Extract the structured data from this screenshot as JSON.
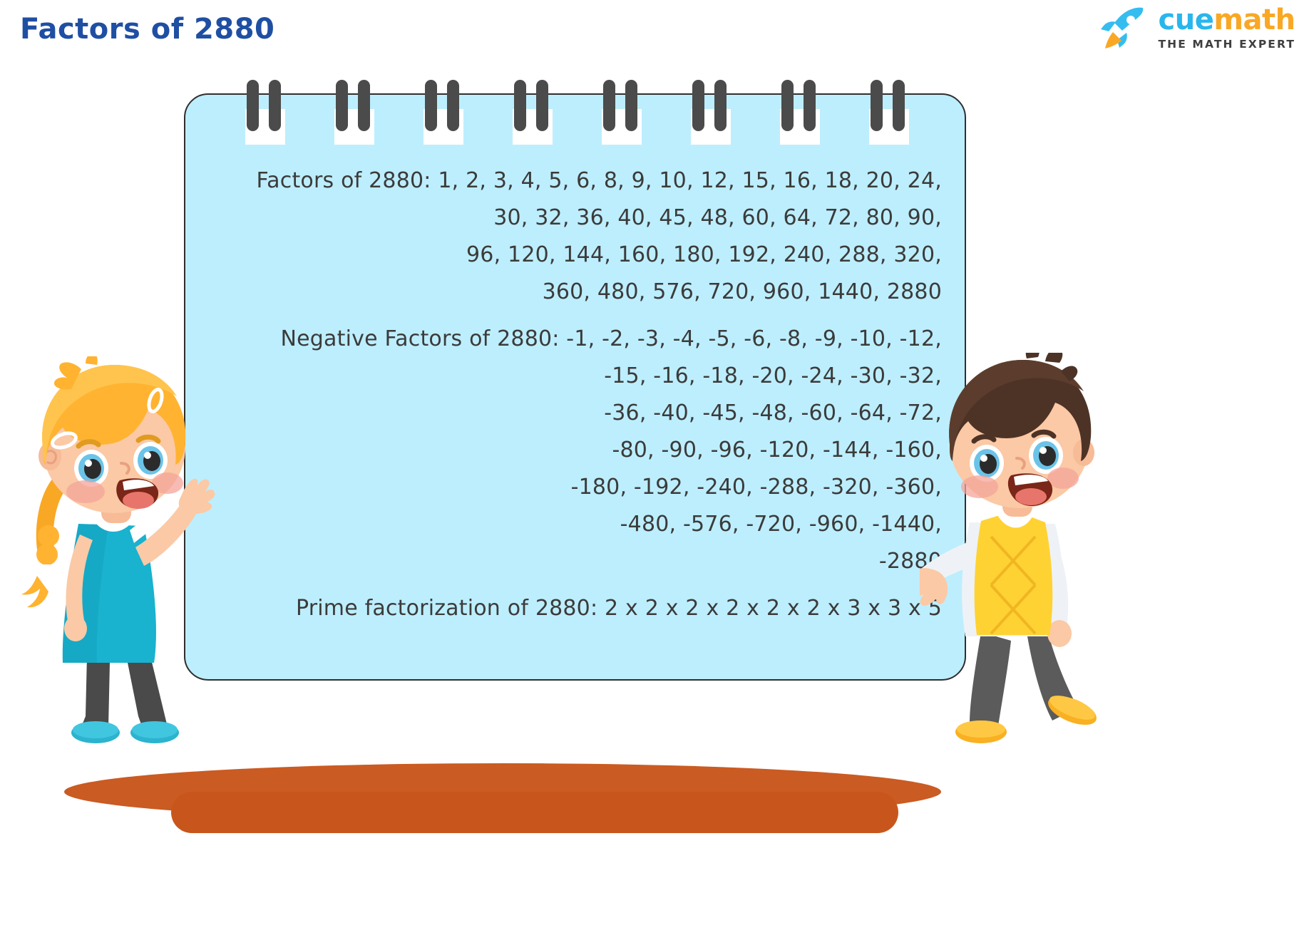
{
  "header": {
    "title": "Factors of 2880",
    "title_color": "#1f4fa3",
    "brand": {
      "name_part1": "cue",
      "name_part2": "math",
      "tagline": "THE MATH EXPERT",
      "cue_color": "#29b6ed",
      "math_color": "#f9a825",
      "rocket_icon": "rocket-icon"
    }
  },
  "notepad": {
    "background_color": "#bdeefd",
    "ring_color": "#4b4b4b",
    "ring_count": 8,
    "content": {
      "factors_label": "Factors of 2880:",
      "factors_lines": [
        "Factors of 2880: 1, 2, 3, 4, 5, 6, 8, 9, 10, 12, 15, 16, 18, 20, 24,",
        "30, 32, 36, 40, 45, 48, 60, 64, 72, 80, 90,",
        "96, 120, 144, 160, 180, 192, 240, 288, 320,",
        "360, 480, 576, 720, 960, 1440, 2880"
      ],
      "negative_label": "Negative Factors of 2880:",
      "negative_lines": [
        "Negative Factors of 2880: -1, -2, -3, -4, -5, -6, -8, -9, -10, -12,",
        "-15, -16, -18, -20, -24, -30, -32,",
        "-36, -40, -45, -48, -60, -64, -72,",
        "-80, -90, -96, -120, -144, -160,",
        "-180, -192, -240, -288, -320, -360,",
        "-480, -576, -720, -960, -1440,",
        "-2880"
      ],
      "prime_label": "Prime factorization of 2880:",
      "prime_line": "Prime factorization of 2880: 2 x 2 x 2 x 2 x 2 x 2 x 3 x 3 x 5"
    }
  },
  "illustrations": {
    "girl": "girl-character-waving",
    "boy": "boy-character-pointing",
    "ground_color": "#c8561c"
  },
  "math_data": {
    "number": 2880,
    "positive_factors": [
      1,
      2,
      3,
      4,
      5,
      6,
      8,
      9,
      10,
      12,
      15,
      16,
      18,
      20,
      24,
      30,
      32,
      36,
      40,
      45,
      48,
      60,
      64,
      72,
      80,
      90,
      96,
      120,
      144,
      160,
      180,
      192,
      240,
      288,
      320,
      360,
      480,
      576,
      720,
      960,
      1440,
      2880
    ],
    "negative_factors": [
      -1,
      -2,
      -3,
      -4,
      -5,
      -6,
      -8,
      -9,
      -10,
      -12,
      -15,
      -16,
      -18,
      -20,
      -24,
      -30,
      -32,
      -36,
      -40,
      -45,
      -48,
      -60,
      -64,
      -72,
      -80,
      -90,
      -96,
      -120,
      -144,
      -160,
      -180,
      -192,
      -240,
      -288,
      -320,
      -360,
      -480,
      -576,
      -720,
      -960,
      -1440,
      -2880
    ],
    "prime_factorization": [
      2,
      2,
      2,
      2,
      2,
      2,
      3,
      3,
      5
    ]
  }
}
